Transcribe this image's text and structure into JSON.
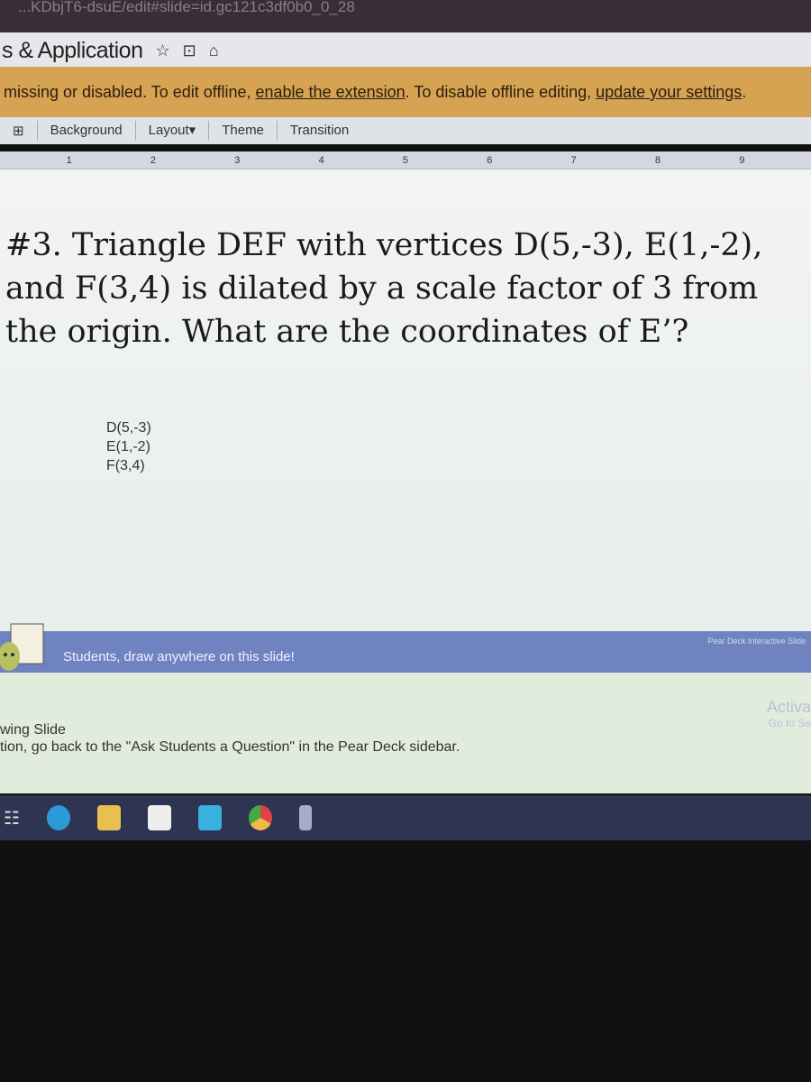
{
  "browser": {
    "url": "...KDbjT6-dsuE/edit#slide=id.gc121c3df0b0_0_28"
  },
  "doc": {
    "title": "s & Application",
    "icons": [
      "star-icon",
      "move-to-folder-icon",
      "cloud-status-icon"
    ]
  },
  "offline_banner": {
    "text_start": "missing or disabled. To edit offline, ",
    "link1": "enable the extension",
    "text_mid": ". To disable offline editing, ",
    "link2": "update your settings",
    "text_end": ".",
    "color": "#d6a352"
  },
  "toolbar": {
    "background": "Background",
    "layout": "Layout▾",
    "theme": "Theme",
    "transition": "Transition"
  },
  "ruler": [
    "1",
    "2",
    "3",
    "4",
    "5",
    "6",
    "7",
    "8",
    "9"
  ],
  "slide": {
    "question": "#3. Triangle DEF with vertices D(5,-3), E(1,-2), and F(3,4) is dilated by a scale factor of 3 from the origin. What are the coordinates of E’?",
    "vertices": [
      "D(5,-3)",
      "E(1,-2)",
      "F(3,4)"
    ]
  },
  "pear_deck": {
    "message": "Students, draw anywhere on this slide!",
    "brand": "Pear Deck Interactive Slide",
    "color": "#6f83c0"
  },
  "notes": {
    "line1": "wing Slide",
    "line2": "tion, go back to the \"Ask Students a Question\" in the Pear Deck sidebar."
  },
  "activation": {
    "title": "Activa",
    "sub": "Go to Se"
  },
  "taskbar": [
    "task-view-icon",
    "edge-icon",
    "file-explorer-icon",
    "store-icon",
    "mail-icon",
    "chrome-icon",
    "device-icon"
  ]
}
